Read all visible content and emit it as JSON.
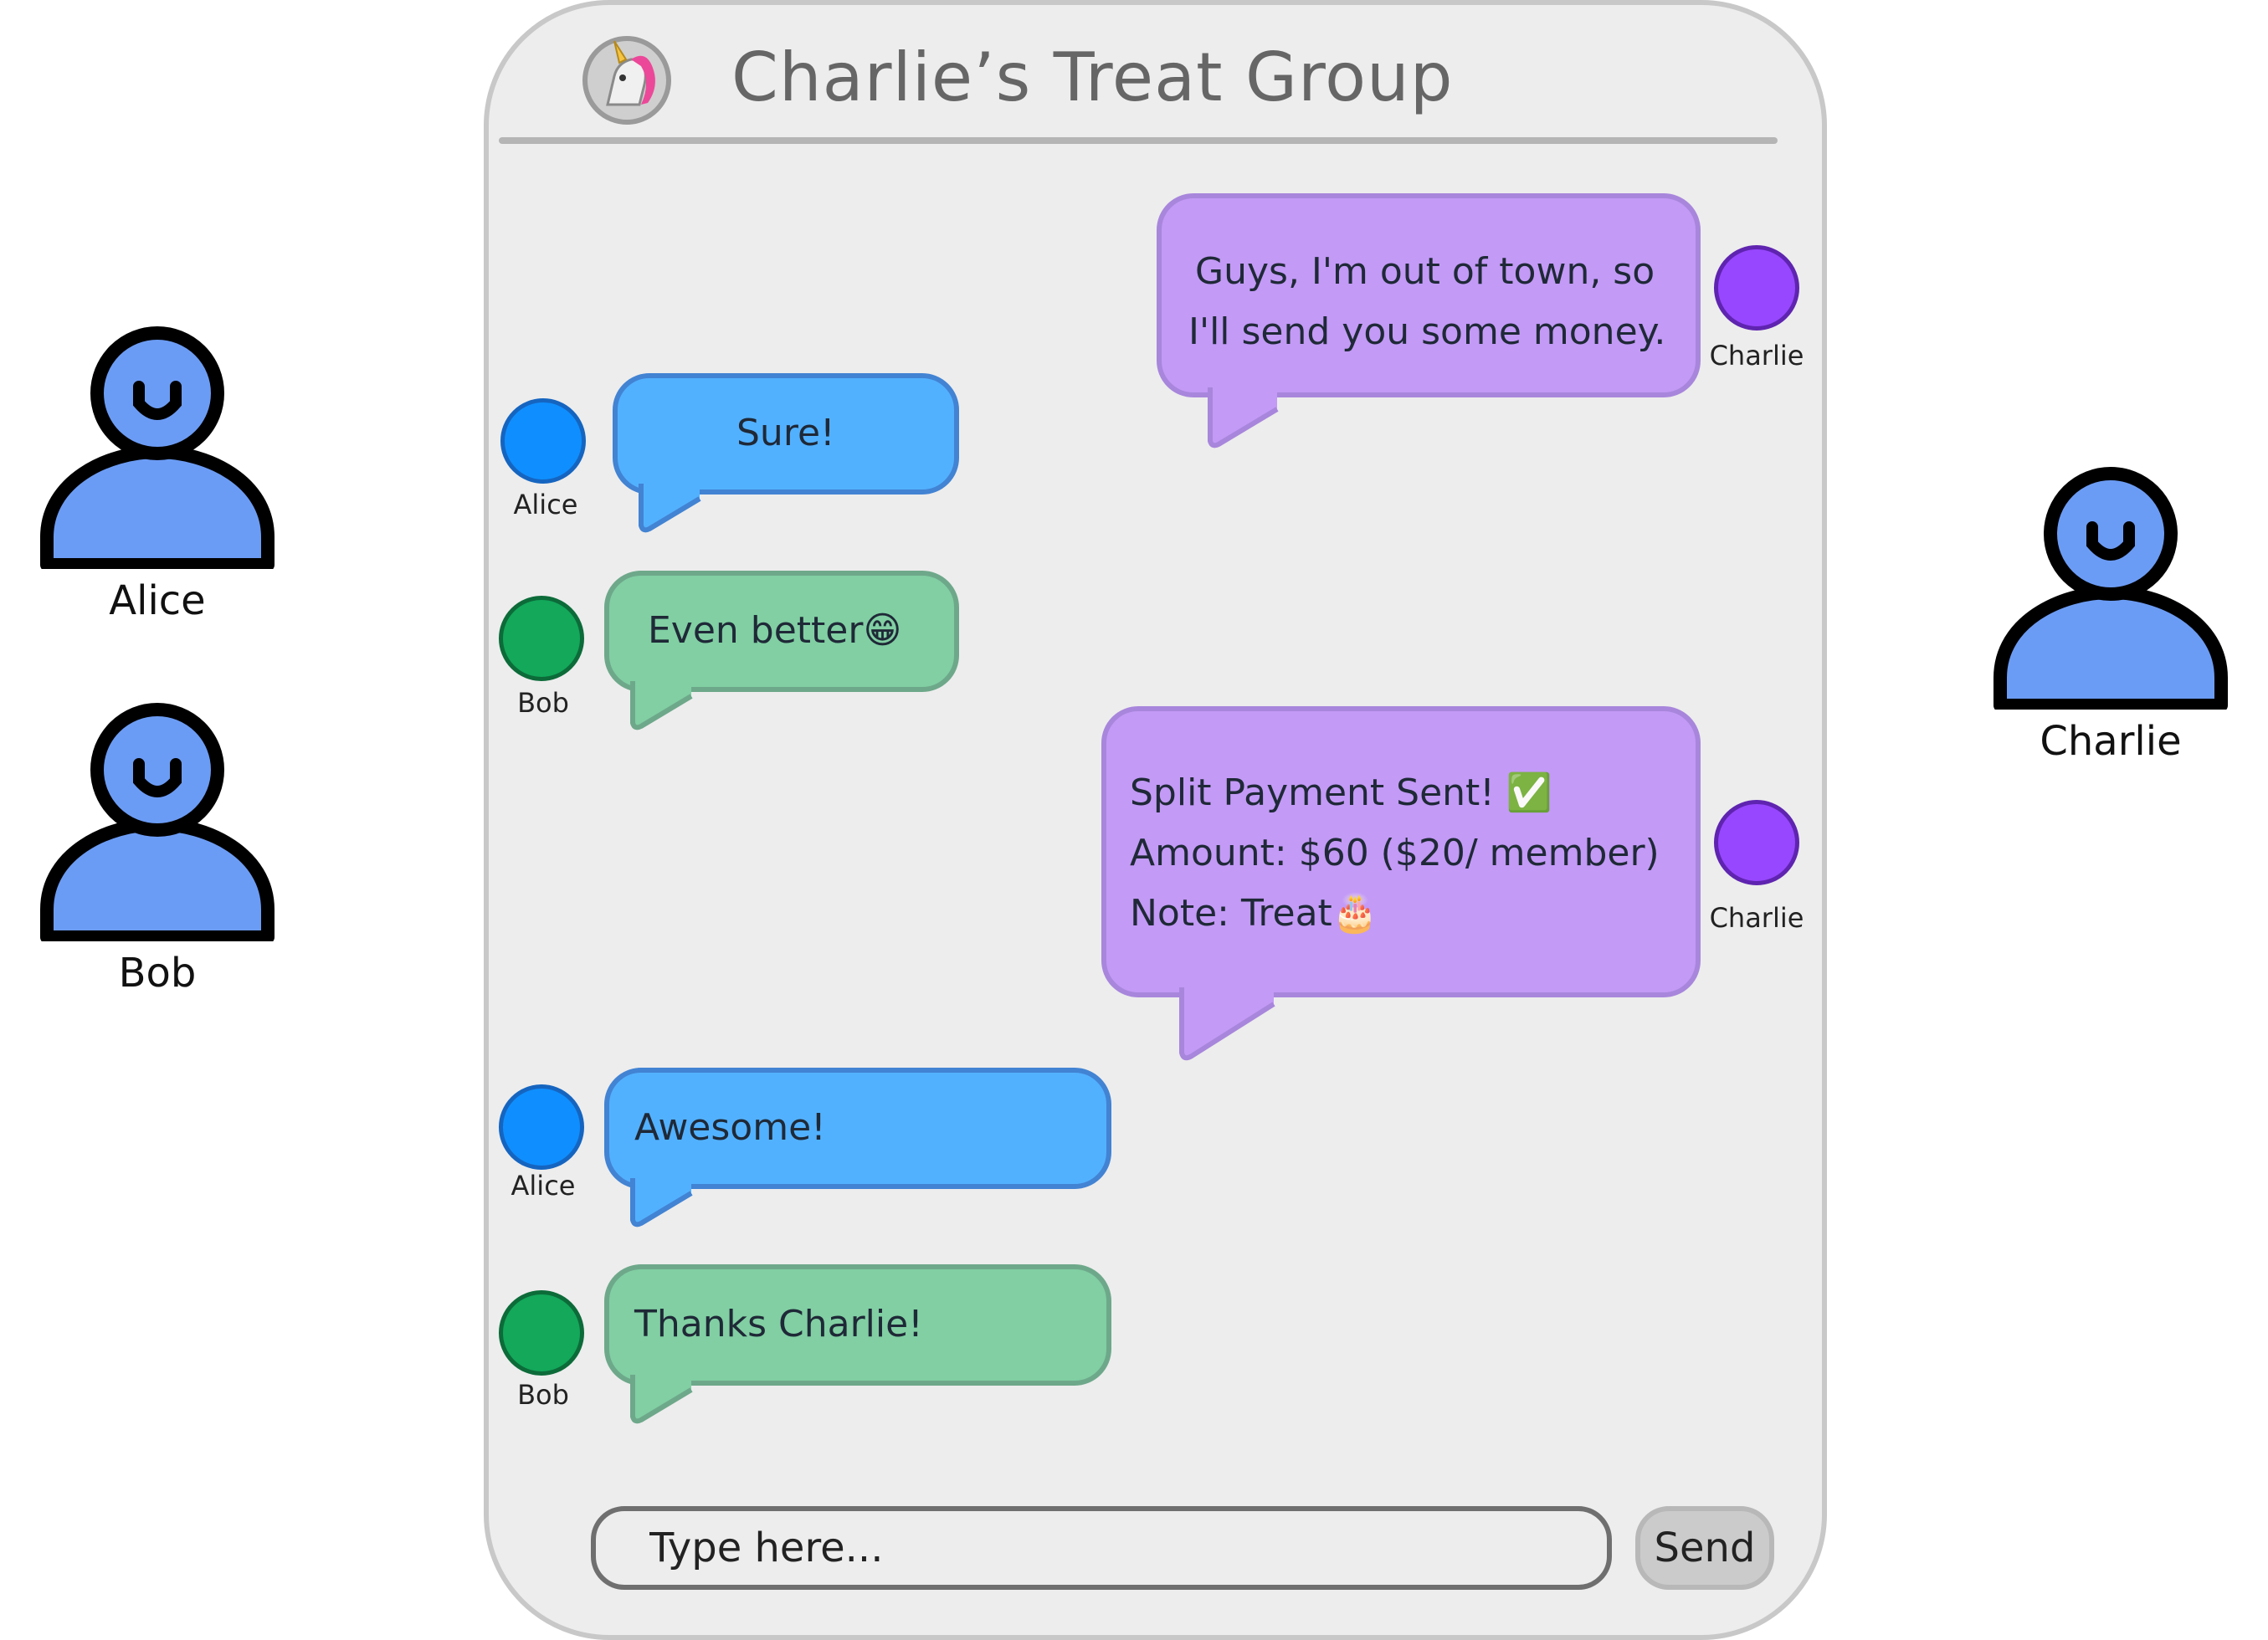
{
  "participants": [
    {
      "name": "Alice"
    },
    {
      "name": "Bob"
    },
    {
      "name": "Charlie"
    }
  ],
  "chat": {
    "title": "Charlie’s Treat Group",
    "group_icon": "unicorn-icon",
    "messages": [
      {
        "sender": "Charlie",
        "lines": [
          "Guys, I'm out of town, so",
          "I'll send you some money."
        ]
      },
      {
        "sender": "Alice",
        "lines": [
          "Sure!"
        ]
      },
      {
        "sender": "Bob",
        "lines": [
          "Even better😁"
        ]
      },
      {
        "sender": "Charlie",
        "lines": [
          "Split Payment Sent! ✅",
          "Amount: $60 ($20/ member)",
          "Note: Treat🎂"
        ]
      },
      {
        "sender": "Alice",
        "lines": [
          "Awesome!"
        ]
      },
      {
        "sender": "Bob",
        "lines": [
          "Thanks Charlie!"
        ]
      }
    ],
    "input": {
      "placeholder": "Type here..."
    },
    "send_label": "Send"
  },
  "colors": {
    "alice_bubble": "#52b1ff",
    "bob_bubble": "#81cfa3",
    "charlie_bubble": "#c39af6",
    "alice_avatar": "#0f8fff",
    "bob_avatar": "#13a85a",
    "charlie_avatar": "#9747ff",
    "person_figure": "#6b9cf5"
  }
}
